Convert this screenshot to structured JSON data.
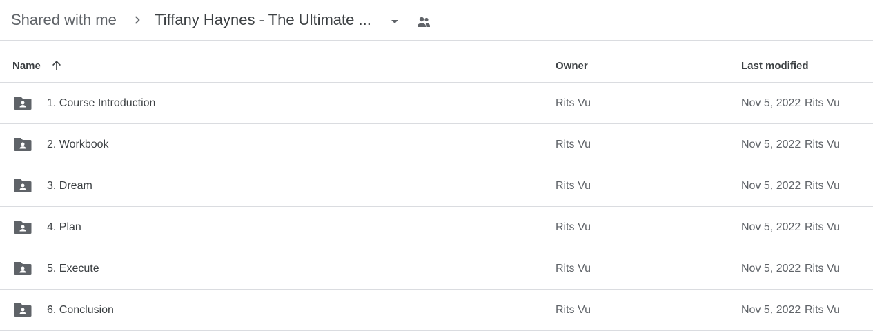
{
  "breadcrumb": {
    "root": "Shared with me",
    "current": "Tiffany Haynes - The Ultimate ..."
  },
  "columns": {
    "name": "Name",
    "owner": "Owner",
    "last_modified": "Last modified",
    "sort": "ascending"
  },
  "colors": {
    "icon": "#5f6368",
    "divider": "#dadce0",
    "text": "#3c4043"
  },
  "rows": [
    {
      "name": "1. Course Introduction",
      "owner": "Rits Vu",
      "date": "Nov 5, 2022",
      "modified_by": "Rits Vu"
    },
    {
      "name": "2. Workbook",
      "owner": "Rits Vu",
      "date": "Nov 5, 2022",
      "modified_by": "Rits Vu"
    },
    {
      "name": "3. Dream",
      "owner": "Rits Vu",
      "date": "Nov 5, 2022",
      "modified_by": "Rits Vu"
    },
    {
      "name": "4. Plan",
      "owner": "Rits Vu",
      "date": "Nov 5, 2022",
      "modified_by": "Rits Vu"
    },
    {
      "name": "5. Execute",
      "owner": "Rits Vu",
      "date": "Nov 5, 2022",
      "modified_by": "Rits Vu"
    },
    {
      "name": "6. Conclusion",
      "owner": "Rits Vu",
      "date": "Nov 5, 2022",
      "modified_by": "Rits Vu"
    }
  ]
}
